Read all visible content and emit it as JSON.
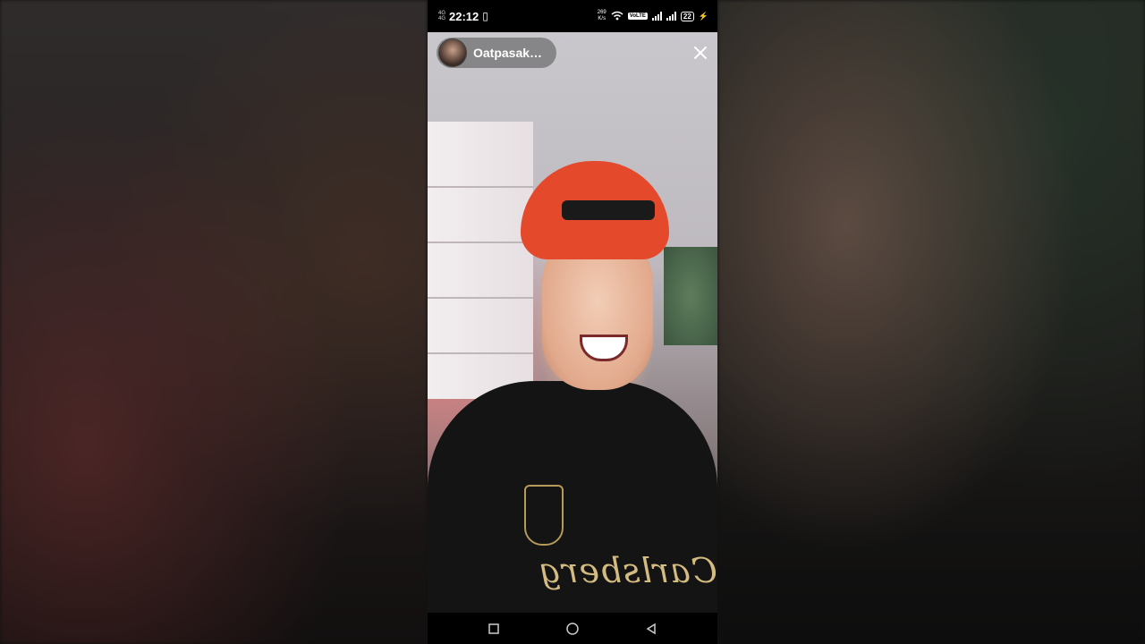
{
  "status_bar": {
    "time": "22:12",
    "speed_value": "269",
    "speed_unit": "K/s",
    "volte": "VoLTE",
    "battery": "22"
  },
  "story": {
    "username": "Oatpasak…",
    "close_icon": "close-icon",
    "shirt_text": "Carlsberg"
  },
  "nav": {
    "recents_icon": "square-icon",
    "home_icon": "circle-icon",
    "back_icon": "triangle-back-icon"
  }
}
